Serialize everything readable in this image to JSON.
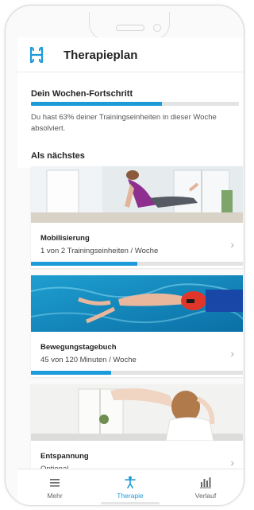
{
  "header": {
    "title": "Therapieplan"
  },
  "progress": {
    "heading": "Dein Wochen-Fortschritt",
    "percent": 63,
    "text": "Du hast 63% deiner Trainingseinheiten in dieser Woche absolviert."
  },
  "next": {
    "heading": "Als nächstes",
    "cards": [
      {
        "name": "Mobilisierung",
        "sub": "1 von 2 Trainingseinheiten / Woche",
        "progress": 0.5,
        "image": "woman-exercise-photo"
      },
      {
        "name": "Bewegungstagebuch",
        "sub": "45 von 120 Minuten / Woche",
        "progress": 0.375,
        "image": "swimmer-photo"
      },
      {
        "name": "Entspannung",
        "sub": "Optional",
        "image": "stretching-woman-photo"
      }
    ]
  },
  "nav": [
    {
      "label": "Mehr",
      "icon": "menu-icon",
      "active": false
    },
    {
      "label": "Therapie",
      "icon": "person-icon",
      "active": true
    },
    {
      "label": "Verlauf",
      "icon": "bar-chart-icon",
      "active": false
    }
  ],
  "colors": {
    "accent": "#1d9ad8",
    "track": "#e3e3e3"
  }
}
